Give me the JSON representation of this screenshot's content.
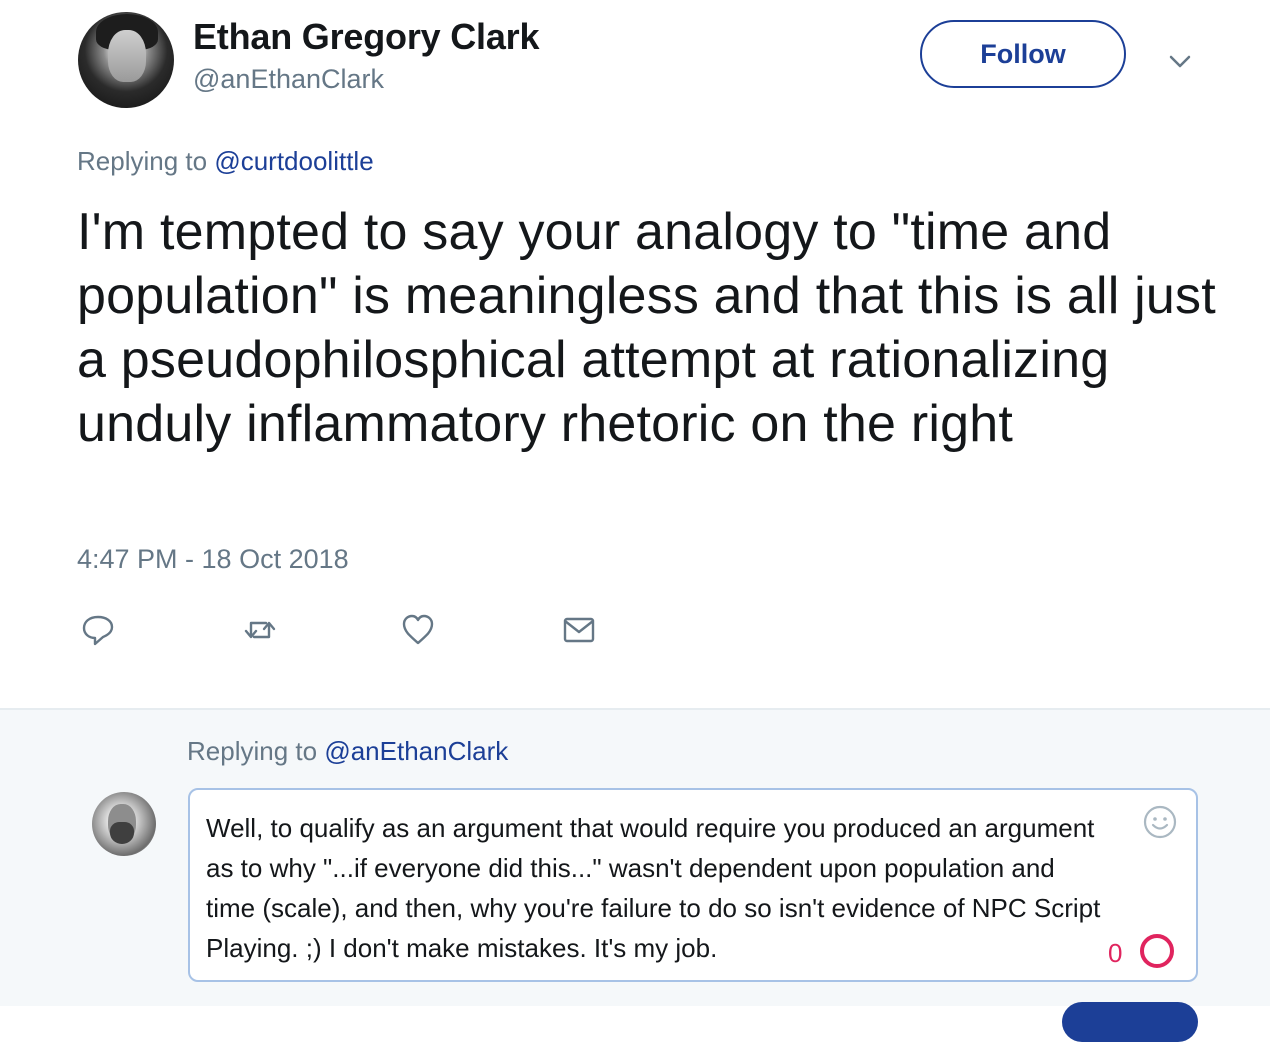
{
  "tweet": {
    "author_name": "Ethan Gregory Clark",
    "author_handle": "@anEthanClark",
    "follow_label": "Follow",
    "replying_prefix": "Replying to ",
    "replying_mention": "@curtdoolittle",
    "text": "I'm tempted to say your analogy to \"time and population\" is meaningless and that this is all just a pseudophilosphical attempt at rationalizing unduly inflammatory rhetoric on the right",
    "timestamp": "4:47 PM - 18 Oct 2018",
    "actions": [
      "reply-icon",
      "retweet-icon",
      "like-icon",
      "message-icon"
    ]
  },
  "reply": {
    "replying_prefix": "Replying to ",
    "replying_mention": "@anEthanClark",
    "draft_text": "Well, to qualify as an argument that would require you produced an argument as to why \"...if everyone did this...\" wasn't dependent upon population and time (scale), and then, why you're failure to do so isn't evidence of NPC Script Playing. ;) I don't make mistakes. It's my job.",
    "remaining_chars": "0",
    "emoji_icon": "smiley-icon"
  },
  "colors": {
    "accent": "#1c3f97",
    "muted": "#657786",
    "warning": "#e0245e",
    "reply_bg": "#f5f8fa"
  }
}
